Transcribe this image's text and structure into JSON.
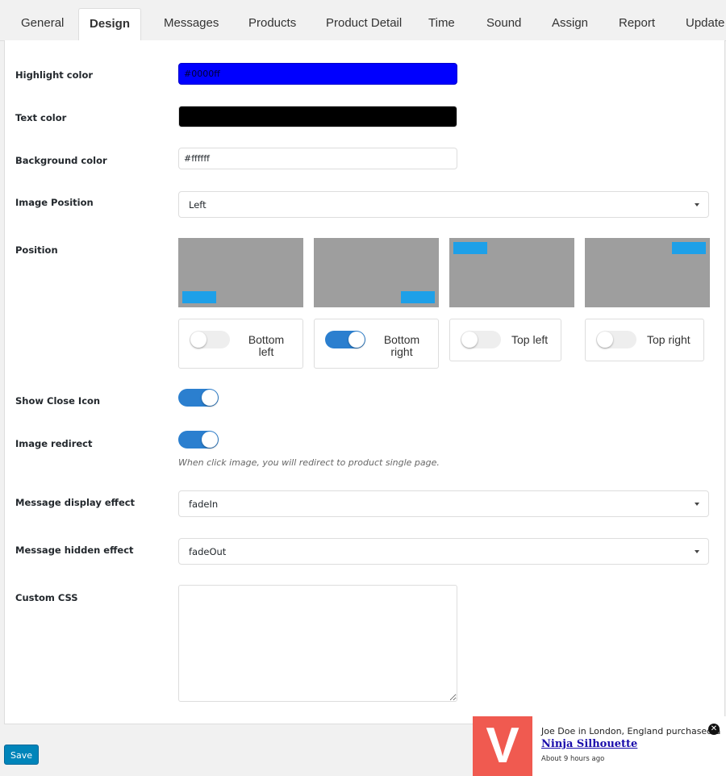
{
  "tabs": [
    "General",
    "Design",
    "Messages",
    "Products",
    "Product Detail",
    "Time",
    "Sound",
    "Assign",
    "Report",
    "Update"
  ],
  "active_tab": "Design",
  "fields": {
    "highlight_label": "Highlight color",
    "highlight_value": "#0000ff",
    "highlight_color": "#0000ff",
    "text_label": "Text color",
    "text_color": "#000000",
    "bg_label": "Background color",
    "bg_value": "#ffffff",
    "image_position_label": "Image Position",
    "image_position_value": "Left",
    "position_label": "Position",
    "positions": [
      {
        "label": "Bottom left",
        "on": false
      },
      {
        "label": "Bottom right",
        "on": true
      },
      {
        "label": "Top left",
        "on": false
      },
      {
        "label": "Top right",
        "on": false
      }
    ],
    "close_icon_label": "Show Close Icon",
    "close_icon_on": true,
    "redirect_label": "Image redirect",
    "redirect_on": true,
    "redirect_hint": "When click image, you will redirect to product single page.",
    "display_effect_label": "Message display effect",
    "display_effect_value": "fadeIn",
    "hidden_effect_label": "Message hidden effect",
    "hidden_effect_value": "fadeOut",
    "css_label": "Custom CSS",
    "css_value": ""
  },
  "save_label": "Save",
  "popup": {
    "logo_letter": "V",
    "message": "Joe Doe in London, England purchased a",
    "product": "Ninja Silhouette",
    "time": "About 9 hours ago",
    "close_icon": "close-circle-icon"
  }
}
